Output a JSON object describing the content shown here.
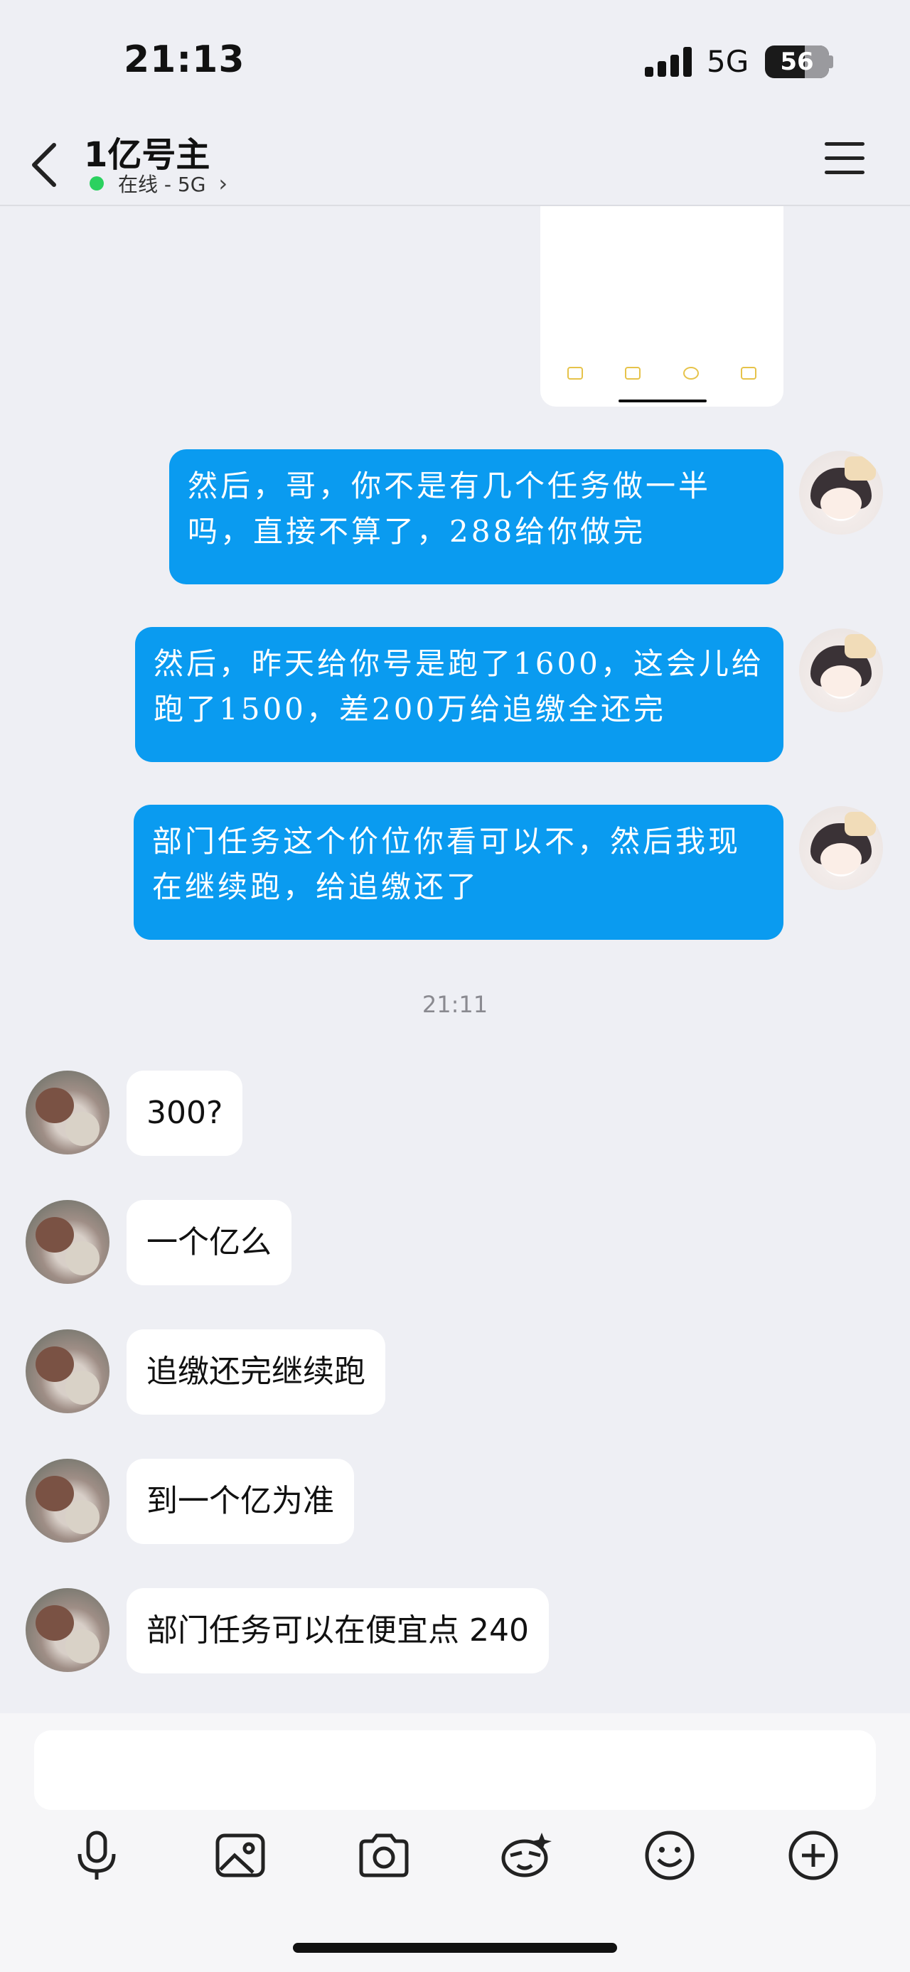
{
  "status_bar": {
    "time": "21:13",
    "network": "5G",
    "battery": "56",
    "battery_level": 0.56
  },
  "header": {
    "title": "1亿号主",
    "presence": "在线 - 5G"
  },
  "outgoing": [
    {
      "text": "然后，哥，你不是有几个任务做一半吗，直接不算了，288给你做完"
    },
    {
      "text": "然后，昨天给你号是跑了1600，这会儿给跑了1500，差200万给追缴全还完"
    },
    {
      "text": "部门任务这个价位你看可以不，然后我现在继续跑，给追缴还了"
    }
  ],
  "divider_time": "21:11",
  "incoming": [
    {
      "text": "300?"
    },
    {
      "text": "一个亿么"
    },
    {
      "text": "追缴还完继续跑"
    },
    {
      "text": "到一个亿为准"
    },
    {
      "text": "部门任务可以在便宜点 240"
    }
  ],
  "toolbar": {
    "icons": [
      "microphone-icon",
      "image-icon",
      "camera-icon",
      "sticker-icon",
      "emoji-icon",
      "plus-icon"
    ]
  },
  "colors": {
    "outgoing_bubble": "#0a9bf0",
    "online_dot": "#2bd15f",
    "background": "#eeeff4"
  }
}
